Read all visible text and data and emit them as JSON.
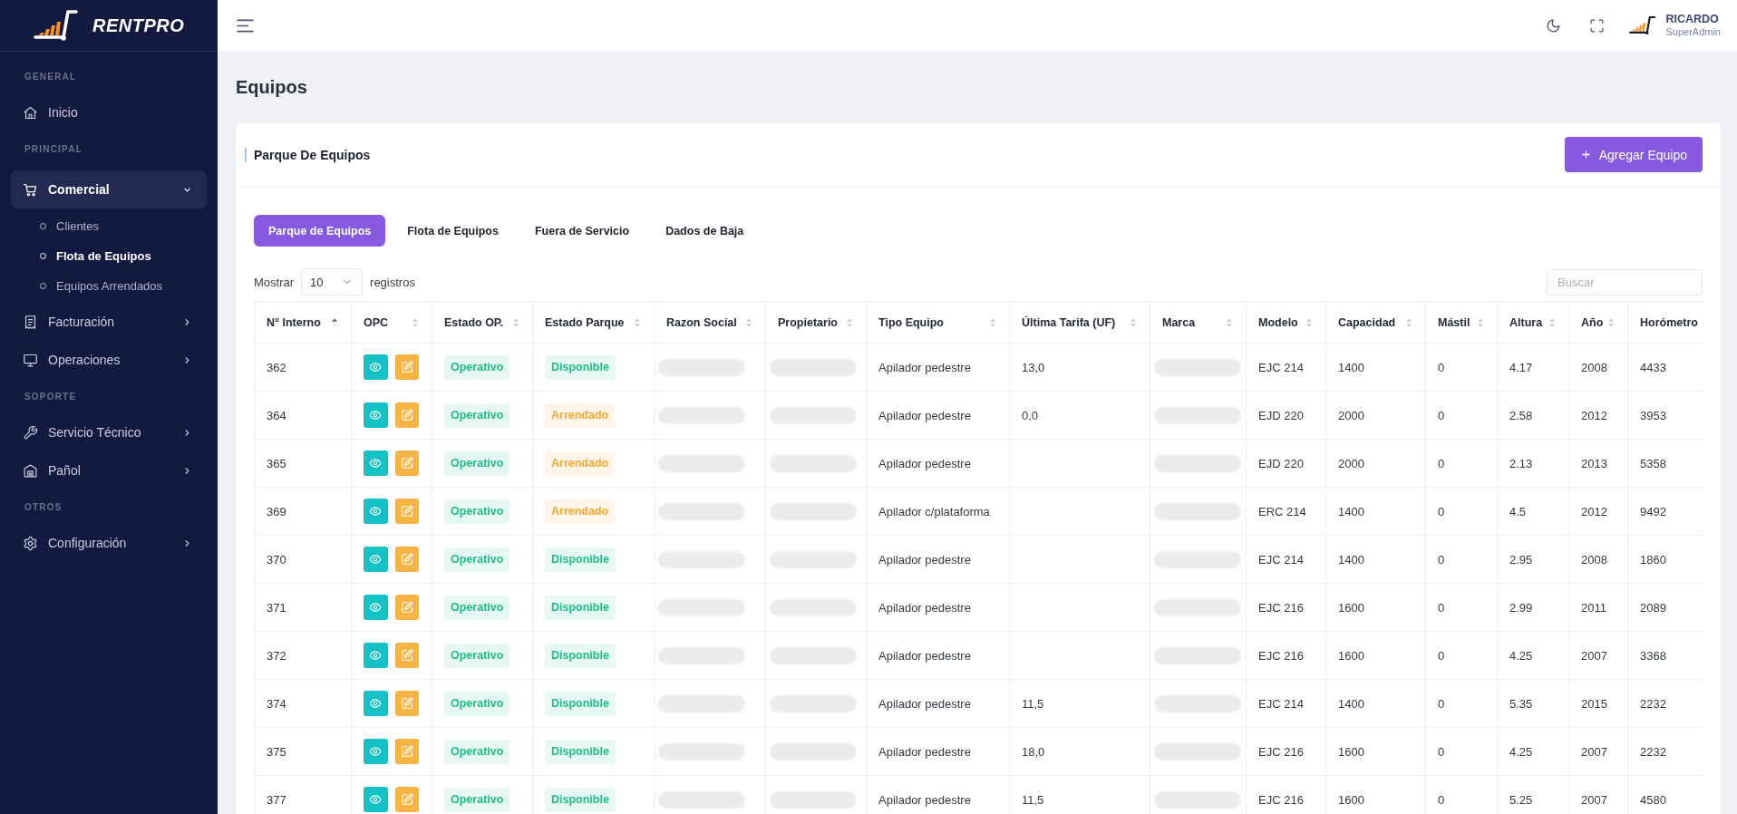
{
  "sidebar": {
    "brand": "RENTPRO",
    "sections": [
      {
        "label": "GENERAL",
        "items": [
          {
            "label": "Inicio",
            "kind": "link",
            "expanded": false
          }
        ]
      },
      {
        "label": "PRINCIPAL",
        "items": [
          {
            "label": "Comercial",
            "kind": "group",
            "expanded": true,
            "children": [
              {
                "label": "Clientes",
                "selected": false
              },
              {
                "label": "Flota de Equipos",
                "selected": true
              },
              {
                "label": "Equipos Arrendados",
                "selected": false
              }
            ]
          },
          {
            "label": "Facturación",
            "kind": "group",
            "expanded": false
          },
          {
            "label": "Operaciones",
            "kind": "group",
            "expanded": false
          }
        ]
      },
      {
        "label": "SOPORTE",
        "items": [
          {
            "label": "Servicio Técnico",
            "kind": "group",
            "expanded": false
          },
          {
            "label": "Pañol",
            "kind": "group",
            "expanded": false
          }
        ]
      },
      {
        "label": "OTROS",
        "items": [
          {
            "label": "Configuración",
            "kind": "group",
            "expanded": false
          }
        ]
      }
    ]
  },
  "topbar": {
    "user": {
      "name": "RICARDO",
      "role": "SuperAdmin"
    }
  },
  "page": {
    "title": "Equipos"
  },
  "card": {
    "title": "Parque De Equipos",
    "add_button": "Agregar Equipo"
  },
  "tabs": [
    {
      "label": "Parque de Equipos",
      "selected": true
    },
    {
      "label": "Flota de Equipos",
      "selected": false
    },
    {
      "label": "Fuera de Servicio",
      "selected": false
    },
    {
      "label": "Dados de Baja",
      "selected": false
    }
  ],
  "length_menu": {
    "prefix": "Mostrar",
    "value": "10",
    "suffix": "registros"
  },
  "search": {
    "placeholder": "Buscar"
  },
  "table": {
    "columns": [
      {
        "label": "N° Interno",
        "kind": "text",
        "sorted": true
      },
      {
        "label": "OPC",
        "kind": "actions",
        "sorted": false
      },
      {
        "label": "Estado OP.",
        "kind": "status",
        "sorted": false
      },
      {
        "label": "Estado Parque",
        "kind": "status",
        "sorted": false
      },
      {
        "label": "Razon Social",
        "kind": "blurred",
        "sorted": false
      },
      {
        "label": "Propietario",
        "kind": "blurred",
        "sorted": false
      },
      {
        "label": "Tipo Equipo",
        "kind": "text",
        "sorted": false
      },
      {
        "label": "Última Tarifa (UF)",
        "kind": "text",
        "sorted": false
      },
      {
        "label": "Marca",
        "kind": "blurred",
        "sorted": false
      },
      {
        "label": "Modelo",
        "kind": "text",
        "sorted": false
      },
      {
        "label": "Capacidad",
        "kind": "text",
        "sorted": false
      },
      {
        "label": "Mástil",
        "kind": "text",
        "sorted": false
      },
      {
        "label": "Altura",
        "kind": "text",
        "sorted": false
      },
      {
        "label": "Año",
        "kind": "text",
        "sorted": false
      },
      {
        "label": "Horómetro",
        "kind": "text"
      }
    ],
    "rows": [
      {
        "n_interno": "362",
        "estado_op": {
          "label": "Operativo",
          "color": "#1fbd86"
        },
        "estado_parque": {
          "label": "Disponible",
          "color": "#1fbd86"
        },
        "tipo_equipo": "Apilador pedestre",
        "ultima_tarifa": "13,0",
        "modelo": "EJC 214",
        "capacidad": "1400",
        "mastil": "0",
        "altura": "4.17",
        "anio": "2008",
        "horometro": "4433"
      },
      {
        "n_interno": "364",
        "estado_op": {
          "label": "Operativo",
          "color": "#1fbd86"
        },
        "estado_parque": {
          "label": "Arrendado",
          "color": "#f5a730"
        },
        "tipo_equipo": "Apilador pedestre",
        "ultima_tarifa": "0,0",
        "modelo": "EJD 220",
        "capacidad": "2000",
        "mastil": "0",
        "altura": "2.58",
        "anio": "2012",
        "horometro": "3953"
      },
      {
        "n_interno": "365",
        "estado_op": {
          "label": "Operativo",
          "color": "#1fbd86"
        },
        "estado_parque": {
          "label": "Arrendado",
          "color": "#f5a730"
        },
        "tipo_equipo": "Apilador pedestre",
        "modelo": "EJD 220",
        "capacidad": "2000",
        "mastil": "0",
        "altura": "2.13",
        "anio": "2013",
        "horometro": "5358"
      },
      {
        "n_interno": "369",
        "estado_op": {
          "label": "Operativo",
          "color": "#1fbd86"
        },
        "estado_parque": {
          "label": "Arrendado",
          "color": "#f5a730"
        },
        "tipo_equipo": "Apilador c/plataforma",
        "modelo": "ERC 214",
        "capacidad": "1400",
        "mastil": "0",
        "altura": "4.5",
        "anio": "2012",
        "horometro": "9492"
      },
      {
        "n_interno": "370",
        "estado_op": {
          "label": "Operativo",
          "color": "#1fbd86"
        },
        "estado_parque": {
          "label": "Disponible",
          "color": "#1fbd86"
        },
        "tipo_equipo": "Apilador pedestre",
        "modelo": "EJC 214",
        "capacidad": "1400",
        "mastil": "0",
        "altura": "2.95",
        "anio": "2008",
        "horometro": "1860"
      },
      {
        "n_interno": "371",
        "estado_op": {
          "label": "Operativo",
          "color": "#1fbd86"
        },
        "estado_parque": {
          "label": "Disponible",
          "color": "#1fbd86"
        },
        "tipo_equipo": "Apilador pedestre",
        "modelo": "EJC 216",
        "capacidad": "1600",
        "mastil": "0",
        "altura": "2.99",
        "anio": "2011",
        "horometro": "2089"
      },
      {
        "n_interno": "372",
        "estado_op": {
          "label": "Operativo",
          "color": "#1fbd86"
        },
        "estado_parque": {
          "label": "Disponible",
          "color": "#1fbd86"
        },
        "tipo_equipo": "Apilador pedestre",
        "modelo": "EJC 216",
        "capacidad": "1600",
        "mastil": "0",
        "altura": "4.25",
        "anio": "2007",
        "horometro": "3368"
      },
      {
        "n_interno": "374",
        "estado_op": {
          "label": "Operativo",
          "color": "#1fbd86"
        },
        "estado_parque": {
          "label": "Disponible",
          "color": "#1fbd86"
        },
        "tipo_equipo": "Apilador pedestre",
        "ultima_tarifa": "11,5",
        "modelo": "EJC 214",
        "capacidad": "1400",
        "mastil": "0",
        "altura": "5.35",
        "anio": "2015",
        "horometro": "2232"
      },
      {
        "n_interno": "375",
        "estado_op": {
          "label": "Operativo",
          "color": "#1fbd86"
        },
        "estado_parque": {
          "label": "Disponible",
          "color": "#1fbd86"
        },
        "tipo_equipo": "Apilador pedestre",
        "ultima_tarifa": "18,0",
        "modelo": "EJC 216",
        "capacidad": "1600",
        "mastil": "0",
        "altura": "4.25",
        "anio": "2007",
        "horometro": "2232"
      },
      {
        "n_interno": "377",
        "estado_op": {
          "label": "Operativo",
          "color": "#1fbd86"
        },
        "estado_parque": {
          "label": "Disponible",
          "color": "#1fbd86"
        },
        "tipo_equipo": "Apilador pedestre",
        "ultima_tarifa": "11,5",
        "modelo": "EJC 216",
        "capacidad": "1600",
        "mastil": "0",
        "altura": "5.25",
        "anio": "2007",
        "horometro": "4580"
      }
    ]
  }
}
